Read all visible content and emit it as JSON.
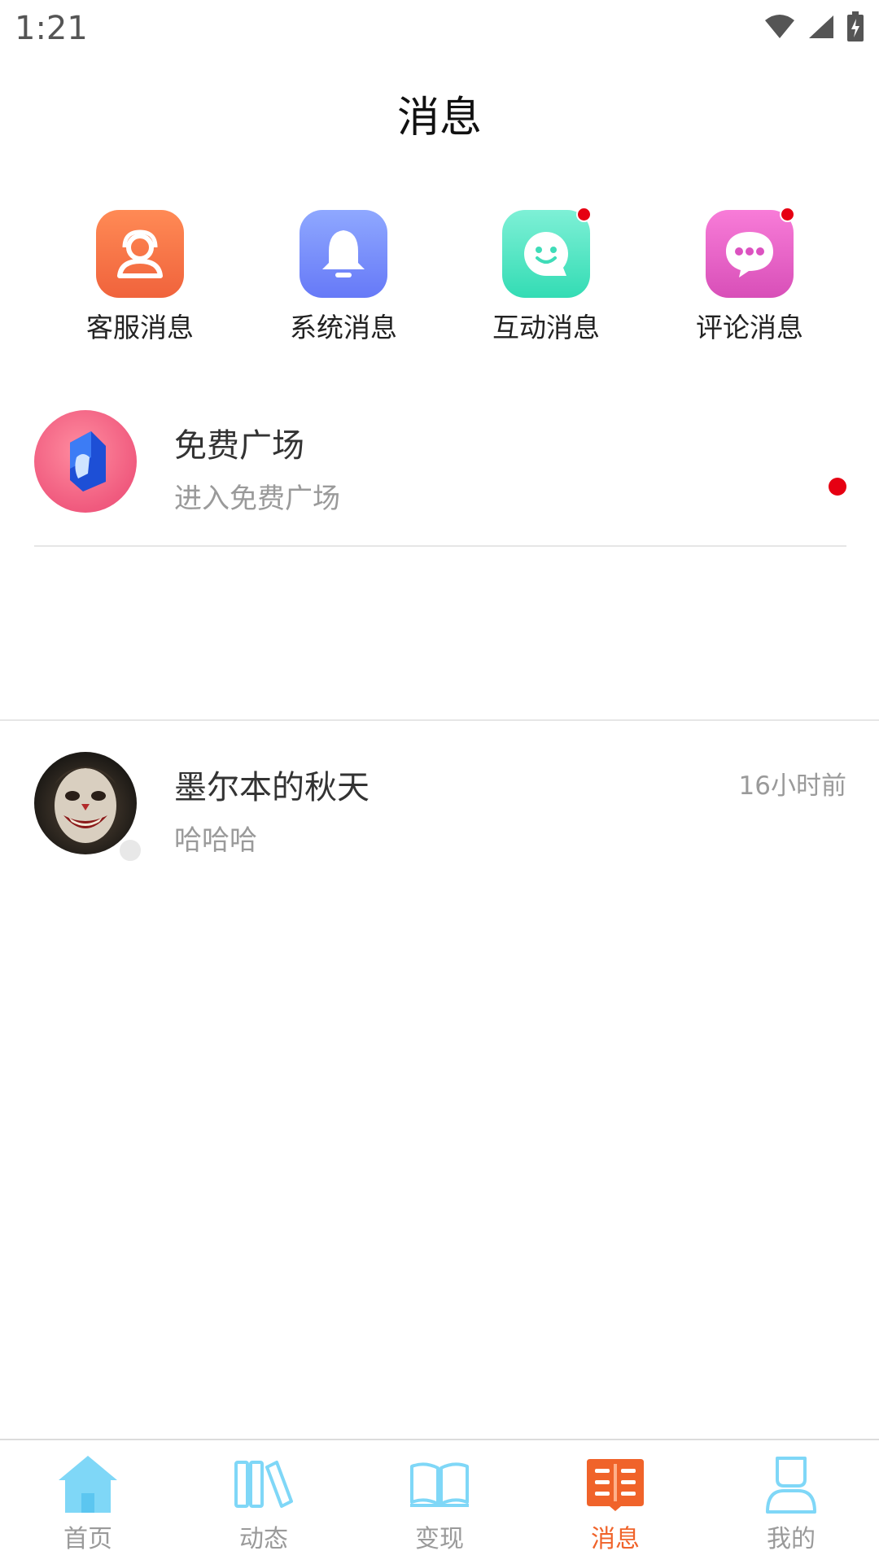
{
  "status_bar": {
    "time": "1:21"
  },
  "header": {
    "title": "消息"
  },
  "categories": [
    {
      "label": "客服消息",
      "icon": "headset-person-icon",
      "color": "#f26a3e",
      "unread": false
    },
    {
      "label": "系统消息",
      "icon": "bell-icon",
      "color": "#6f82f8",
      "unread": false
    },
    {
      "label": "互动消息",
      "icon": "smiley-chat-icon",
      "color": "#3fe0bb",
      "unread": true
    },
    {
      "label": "评论消息",
      "icon": "comment-dots-icon",
      "color": "#e156c4",
      "unread": true
    }
  ],
  "messages": [
    {
      "name": "免费广场",
      "preview": "进入免费广场",
      "time": "",
      "unread": true,
      "avatar": "plaza-logo"
    },
    {
      "name": "墨尔本的秋天",
      "preview": "哈哈哈",
      "time": "16小时前",
      "unread": false,
      "avatar": "joker-photo"
    }
  ],
  "nav": [
    {
      "label": "首页",
      "icon": "home-icon",
      "active": false
    },
    {
      "label": "动态",
      "icon": "books-icon",
      "active": false
    },
    {
      "label": "变现",
      "icon": "open-book-icon",
      "active": false
    },
    {
      "label": "消息",
      "icon": "message-list-icon",
      "active": true
    },
    {
      "label": "我的",
      "icon": "profile-icon",
      "active": false
    }
  ],
  "colors": {
    "accent": "#f0632a",
    "nav_inactive": "#7fd7f7",
    "unread_dot": "#e60012"
  }
}
